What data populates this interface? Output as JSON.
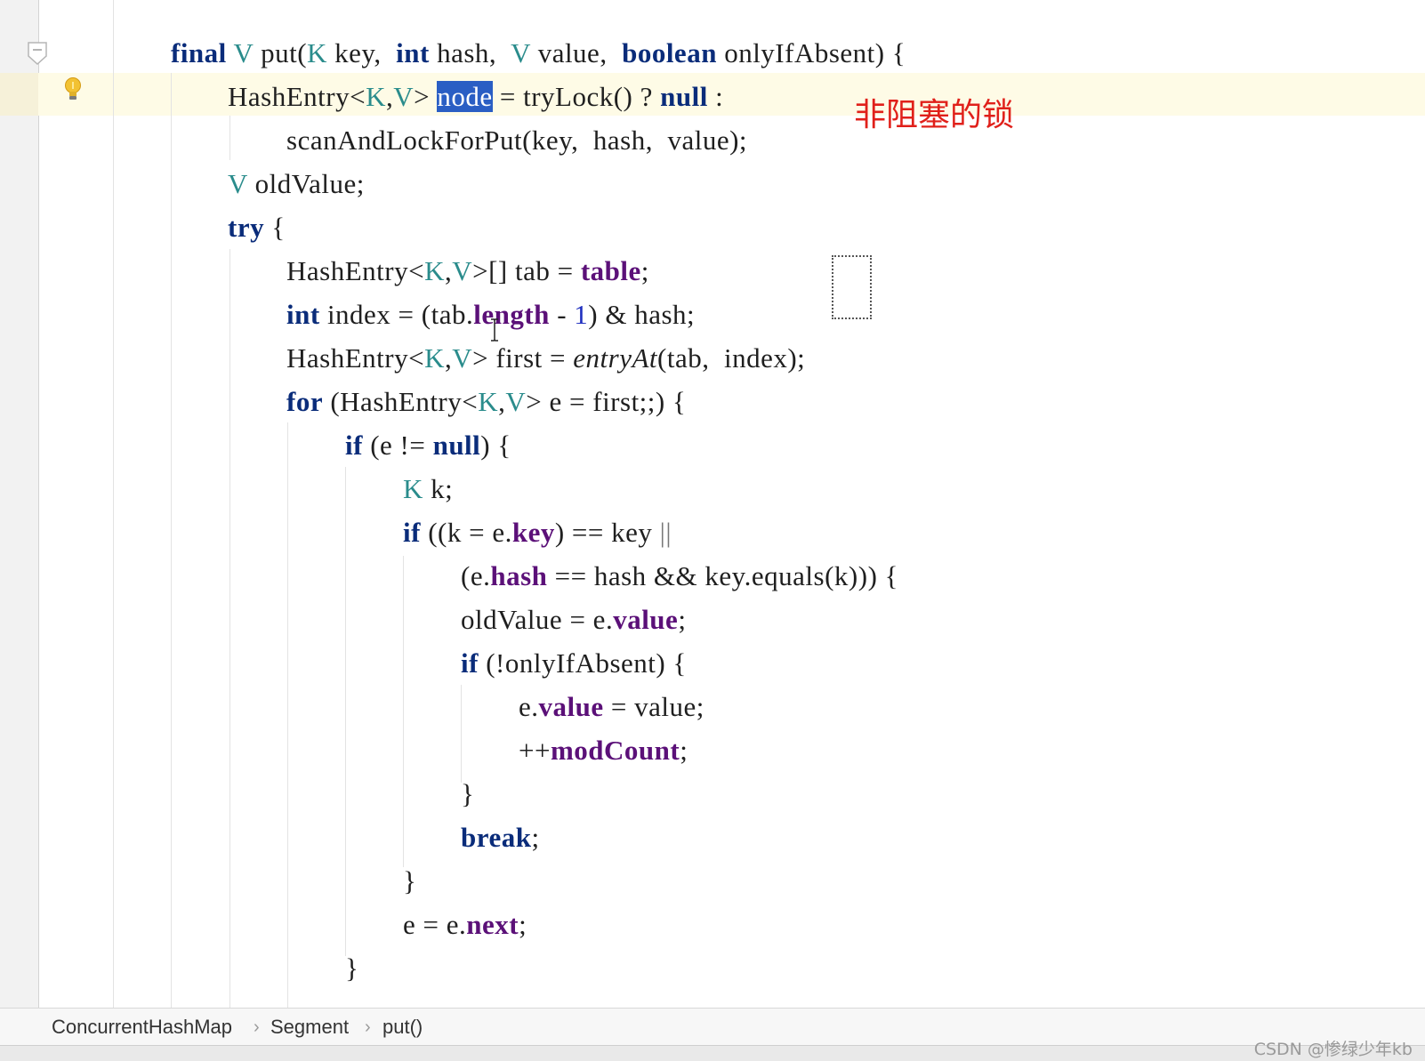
{
  "annotation": "非阻塞的锁",
  "lines": [
    {
      "segs": [
        [
          "kw",
          "final"
        ],
        [
          "t",
          " "
        ],
        [
          "tp",
          "V"
        ],
        [
          "t",
          " put("
        ],
        [
          "tp",
          "K"
        ],
        [
          "t",
          " key,  "
        ],
        [
          "kw",
          "int"
        ],
        [
          "t",
          " hash,  "
        ],
        [
          "tp",
          "V"
        ],
        [
          "t",
          " value,  "
        ],
        [
          "kw",
          "boolean"
        ],
        [
          "t",
          " onlyIfAbsent) {"
        ]
      ]
    },
    {
      "segs": [
        [
          "t",
          "HashEntry<"
        ],
        [
          "tp",
          "K"
        ],
        [
          "t",
          ","
        ],
        [
          "tp",
          "V"
        ],
        [
          "t",
          "> "
        ],
        [
          "sel",
          "node"
        ],
        [
          "t",
          " = tryLock() ? "
        ],
        [
          "kw",
          "null"
        ],
        [
          "t",
          " :"
        ]
      ]
    },
    {
      "segs": [
        [
          "t",
          "scanAndLockForPut(key,  hash,  value);"
        ]
      ]
    },
    {
      "segs": [
        [
          "tp",
          "V"
        ],
        [
          "t",
          " oldValue;"
        ]
      ]
    },
    {
      "segs": [
        [
          "kw",
          "try"
        ],
        [
          "t",
          " {"
        ]
      ]
    },
    {
      "segs": [
        [
          "t",
          "HashEntry<"
        ],
        [
          "tp",
          "K"
        ],
        [
          "t",
          ","
        ],
        [
          "tp",
          "V"
        ],
        [
          "t",
          ">[] tab = "
        ],
        [
          "fld",
          "table"
        ],
        [
          "t",
          ";"
        ]
      ]
    },
    {
      "segs": [
        [
          "kw",
          "int"
        ],
        [
          "t",
          " index = (tab."
        ],
        [
          "fld",
          "length"
        ],
        [
          "t",
          " - "
        ],
        [
          "num",
          "1"
        ],
        [
          "t",
          ") & hash;"
        ]
      ]
    },
    {
      "segs": [
        [
          "t",
          "HashEntry<"
        ],
        [
          "tp",
          "K"
        ],
        [
          "t",
          ","
        ],
        [
          "tp",
          "V"
        ],
        [
          "t",
          "> first = "
        ],
        [
          "it",
          "entryAt"
        ],
        [
          "t",
          "(tab,  index);"
        ]
      ]
    },
    {
      "segs": [
        [
          "kw",
          "for"
        ],
        [
          "t",
          " (HashEntry<"
        ],
        [
          "tp",
          "K"
        ],
        [
          "t",
          ","
        ],
        [
          "tp",
          "V"
        ],
        [
          "t",
          "> e = first;;) {"
        ]
      ]
    },
    {
      "segs": [
        [
          "kw",
          "if"
        ],
        [
          "t",
          " (e != "
        ],
        [
          "kw",
          "null"
        ],
        [
          "t",
          ") {"
        ]
      ]
    },
    {
      "segs": [
        [
          "tp",
          "K"
        ],
        [
          "t",
          " k;"
        ]
      ]
    },
    {
      "segs": [
        [
          "kw",
          "if"
        ],
        [
          "t",
          " ((k = e."
        ],
        [
          "fld",
          "key"
        ],
        [
          "t",
          ") == key "
        ],
        [
          "br",
          "||"
        ]
      ]
    },
    {
      "segs": [
        [
          "t",
          "(e."
        ],
        [
          "fld",
          "hash"
        ],
        [
          "t",
          " == hash && key.equals(k))) {"
        ]
      ]
    },
    {
      "segs": [
        [
          "t",
          "oldValue = e."
        ],
        [
          "fld",
          "value"
        ],
        [
          "t",
          ";"
        ]
      ]
    },
    {
      "segs": [
        [
          "kw",
          "if"
        ],
        [
          "t",
          " (!onlyIfAbsent) {"
        ]
      ]
    },
    {
      "segs": [
        [
          "t",
          "e."
        ],
        [
          "fld",
          "value"
        ],
        [
          "t",
          " = value;"
        ]
      ]
    },
    {
      "segs": [
        [
          "t",
          "++"
        ],
        [
          "fld",
          "modCount"
        ],
        [
          "t",
          ";"
        ]
      ]
    },
    {
      "segs": [
        [
          "t",
          "}"
        ]
      ]
    },
    {
      "segs": [
        [
          "kw",
          "break"
        ],
        [
          "t",
          ";"
        ]
      ]
    },
    {
      "segs": [
        [
          "t",
          "}"
        ]
      ]
    },
    {
      "segs": [
        [
          "t",
          "e = e."
        ],
        [
          "fld",
          "next"
        ],
        [
          "t",
          ";"
        ]
      ]
    },
    {
      "segs": [
        [
          "t",
          "}"
        ]
      ]
    }
  ],
  "breadcrumb": {
    "items": [
      "ConcurrentHashMap",
      "Segment",
      "put()"
    ],
    "separator": "›"
  },
  "watermark": "CSDN @惨绿少年kb",
  "colors": {
    "keyword": "#0a2c7a",
    "type_param": "#2a8c8c",
    "field": "#5b1078",
    "selection": "#2a5ec4",
    "annotation": "#e0201a",
    "caret_row": "#fefbe6"
  },
  "icons": [
    "lightbulb-icon",
    "fold-marker-icon",
    "text-cursor-icon"
  ]
}
